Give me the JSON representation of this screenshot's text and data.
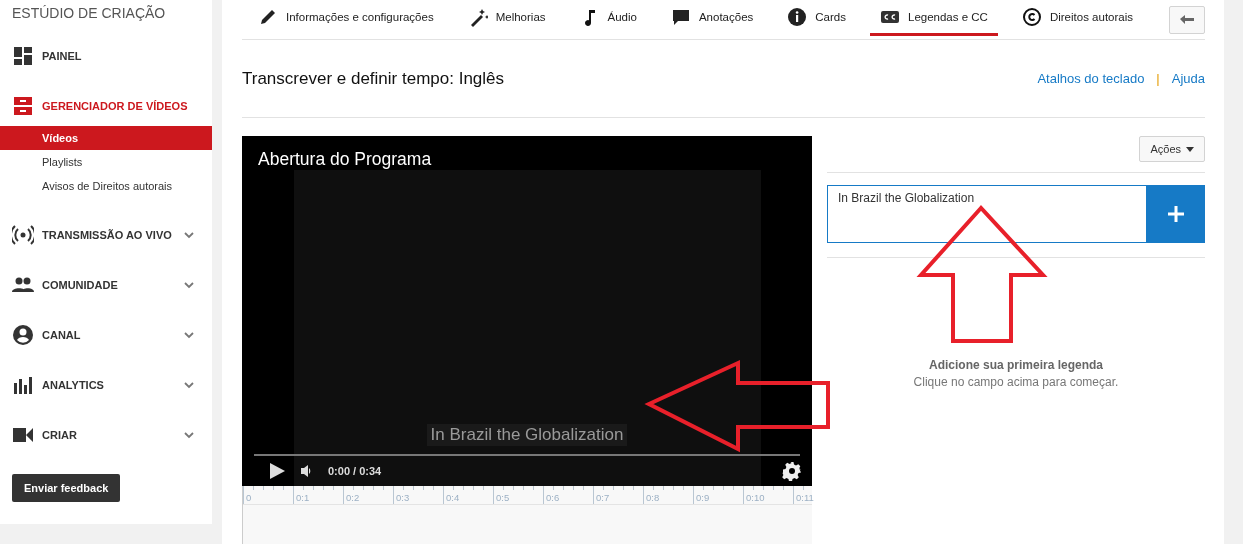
{
  "sidebar": {
    "title": "ESTÚDIO DE CRIAÇÃO",
    "items": [
      {
        "label": "PAINEL",
        "selected": false
      },
      {
        "label": "GERENCIADOR DE VÍDEOS",
        "selected": true,
        "children": [
          {
            "label": "Vídeos",
            "selected": true
          },
          {
            "label": "Playlists",
            "selected": false
          },
          {
            "label": "Avisos de Direitos autorais",
            "selected": false
          }
        ]
      },
      {
        "label": "TRANSMISSÃO AO VIVO",
        "selected": false,
        "expanded": false
      },
      {
        "label": "COMUNIDADE",
        "selected": false,
        "expanded": false
      },
      {
        "label": "CANAL",
        "selected": false,
        "expanded": false
      },
      {
        "label": "ANALYTICS",
        "selected": false,
        "expanded": false
      },
      {
        "label": "CRIAR",
        "selected": false,
        "expanded": false
      }
    ],
    "feedback_button": "Enviar feedback"
  },
  "tabs": [
    {
      "label": "Informações e configurações",
      "selected": false
    },
    {
      "label": "Melhorias",
      "selected": false
    },
    {
      "label": "Áudio",
      "selected": false
    },
    {
      "label": "Anotações",
      "selected": false
    },
    {
      "label": "Cards",
      "selected": false
    },
    {
      "label": "Legendas e CC",
      "selected": true
    },
    {
      "label": "Direitos autorais",
      "selected": false
    }
  ],
  "page_title": "Transcrever e definir tempo: Inglês",
  "links": [
    "Atalhos do teclado",
    "Ajuda"
  ],
  "link_separator": "|",
  "video": {
    "title": "Abertura do Programa",
    "caption": "In Brazil the Globalization",
    "time": "0:00 / 0:34"
  },
  "timeline": [
    "0",
    "0:1",
    "0:2",
    "0:3",
    "0:4",
    "0:5",
    "0:6",
    "0:7",
    "0:8",
    "0:9",
    "0:10",
    "0:11"
  ],
  "actions_button": "Ações",
  "caption_input": {
    "value": "In Brazil the Globalization"
  },
  "empty_state": {
    "title": "Adicione sua primeira legenda",
    "hint": "Clique no campo acima para começar."
  }
}
